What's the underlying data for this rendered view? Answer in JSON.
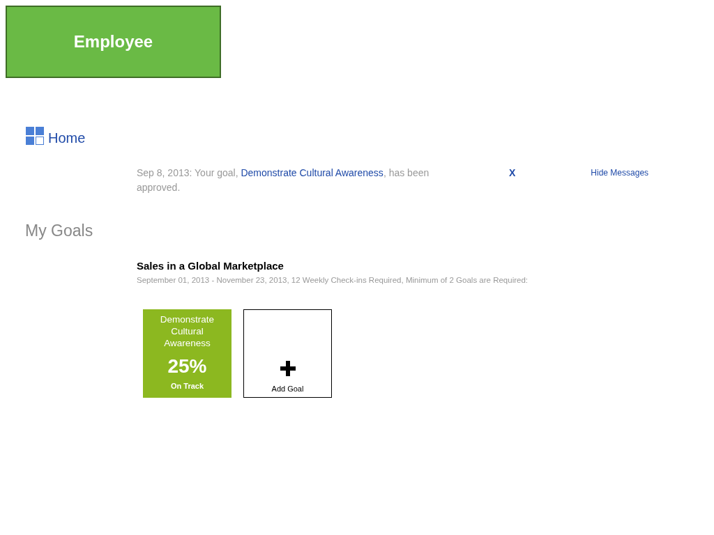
{
  "role_banner": {
    "label": "Employee"
  },
  "nav": {
    "label": "Home"
  },
  "message": {
    "before": "Sep 8, 2013: Your goal, ",
    "link": "Demonstrate Cultural Awareness",
    "after": ", has been approved.",
    "dismiss": "X",
    "hide": "Hide Messages"
  },
  "heading": "My Goals",
  "program": {
    "title": "Sales in a Global Marketplace",
    "details": "September 01, 2013 - November 23, 2013, 12 Weekly Check-ins Required, Minimum of 2 Goals are Required:"
  },
  "tiles": [
    {
      "kind": "goal",
      "title": "Demonstrate Cultural Awareness",
      "percent": "25%",
      "status": "On Track"
    },
    {
      "kind": "add",
      "label": "Add Goal"
    }
  ]
}
